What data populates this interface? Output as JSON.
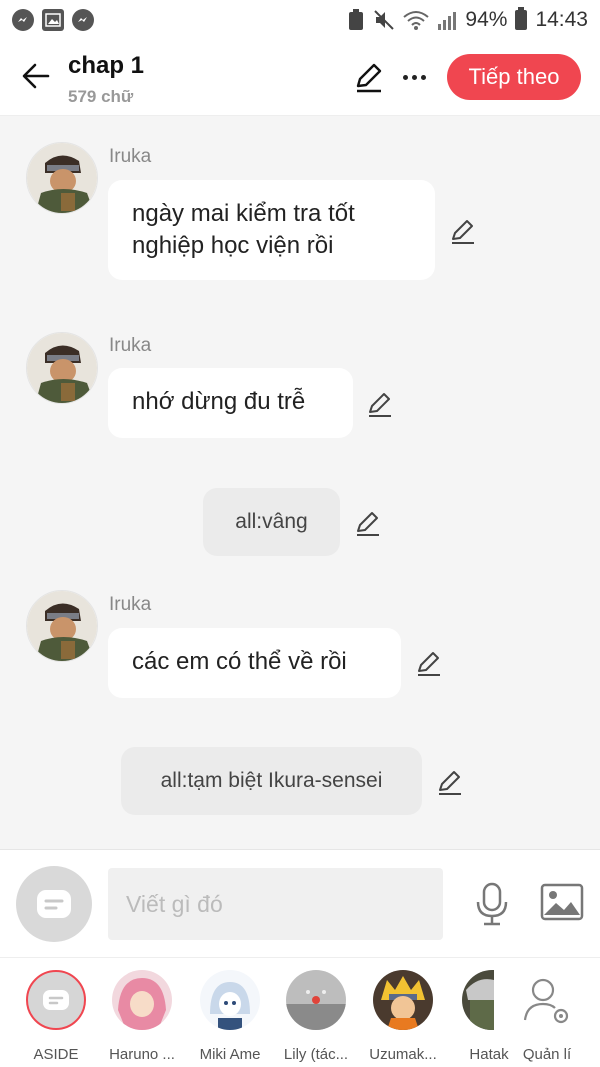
{
  "status_bar": {
    "battery": "94%",
    "time": "14:43"
  },
  "header": {
    "title": "chap 1",
    "word_count": "579 chữ",
    "next_label": "Tiếp theo"
  },
  "messages": [
    {
      "type": "character",
      "name": "Iruka",
      "lines": [
        "ngày mai kiểm tra tốt",
        "nghiệp học viện rồi"
      ]
    },
    {
      "type": "character",
      "name": "Iruka",
      "lines": [
        "nhớ dừng đu trễ"
      ]
    },
    {
      "type": "narration",
      "text": "all:vâng"
    },
    {
      "type": "character",
      "name": "Iruka",
      "lines": [
        "các em có thể về rồi"
      ]
    },
    {
      "type": "narration",
      "text": "all:tạm biệt Ikura-sensei"
    }
  ],
  "input": {
    "placeholder": "Viết gì đó"
  },
  "characters": [
    {
      "label": "ASIDE"
    },
    {
      "label": "Haruno ..."
    },
    {
      "label": "Miki Ame"
    },
    {
      "label": "Lily (tác..."
    },
    {
      "label": "Uzumak..."
    },
    {
      "label": "Hatak"
    },
    {
      "label": "Quản lí"
    }
  ],
  "colors": {
    "accent": "#f04650",
    "background": "#f5f5f5",
    "bubble": "#ffffff",
    "narration": "#ebebeb"
  }
}
